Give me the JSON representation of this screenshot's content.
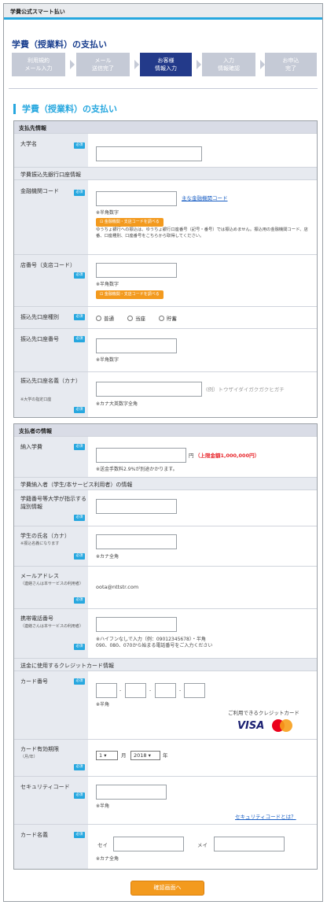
{
  "app_title": "学費公式スマート払い",
  "page_title": "学費（授業料）の支払い",
  "steps": [
    "利用規約\nメール入力",
    "メール\n送信完了",
    "お客様\n情報入力",
    "入力\n情報確認",
    "お申込\n完了"
  ],
  "section_title": "学費（授業料）の支払い",
  "required": "必須",
  "payee": {
    "header": "支払先情報",
    "university": "大学名",
    "bank_sub": "学費振込先銀行口座情報",
    "bank_code": "金融機関コード",
    "bank_code_link": "主な金融機関コード",
    "half_num": "※半角数字",
    "lookup_btn": "金融機関・支店コードを調べる",
    "yucho_note": "ゆうちょ銀行への振込は、ゆうちょ銀行口座番号（記号・番号）では振込めません。振込用の金融機関コード、店番、口座種別、口座番号をこちらから取得してください。",
    "branch": "店番号（支店コード）",
    "acct_type": "振込先口座種別",
    "types": [
      "普通",
      "当座",
      "貯蓄"
    ],
    "acct_num": "振込先口座番号",
    "acct_name": "振込先口座名義（カナ）",
    "acct_name_sub": "※大学の指定口座",
    "acct_name_eg": "(例）トウザイダイガクガクヒガチ",
    "kana_note": "※カナ大英数字全角"
  },
  "payer": {
    "header": "支払者の情報",
    "amount": "納入学費",
    "yen": "円",
    "limit": "（上限金額1,000,000円）",
    "fee_note": "※送金手数料2.9%が別途かかります。",
    "payer_sub": "学費納入者（学生/本サービス利用者）の情報",
    "student_id": "学籍番号等大学が指示する識別情報",
    "student_name": "学生の氏名（カナ）",
    "student_name_sub": "※振込名義になります",
    "kana_full": "※カナ全角",
    "email": "メールアドレス",
    "email_sub": "（連絡さんは本サービスの利用者）",
    "email_value": "oota@nttstr.com",
    "phone": "携帯電話番号",
    "phone_sub": "（連絡さんは本サービスの利用者）",
    "phone_note": "※ハイフンなしで入力（例：09012345678）・半角\n090、080、070から始まる電話番号をご入力ください",
    "card_sub": "送金に使用するクレジットカード情報",
    "card_num": "カード番号",
    "half": "※半角",
    "cards_label": "ご利用できるクレジットカード",
    "visa": "VISA",
    "mastercard": "mastercard",
    "expiry": "カード有効期限",
    "expiry_sub": "（月/年）",
    "month": "1",
    "month_unit": "月",
    "year": "2018",
    "year_unit": "年",
    "cvv": "セキュリティコード",
    "cvv_link": "セキュリティコードとは？",
    "holder": "カード名義",
    "sei": "セイ",
    "mei": "メイ"
  },
  "confirm_button": "確認画面へ"
}
